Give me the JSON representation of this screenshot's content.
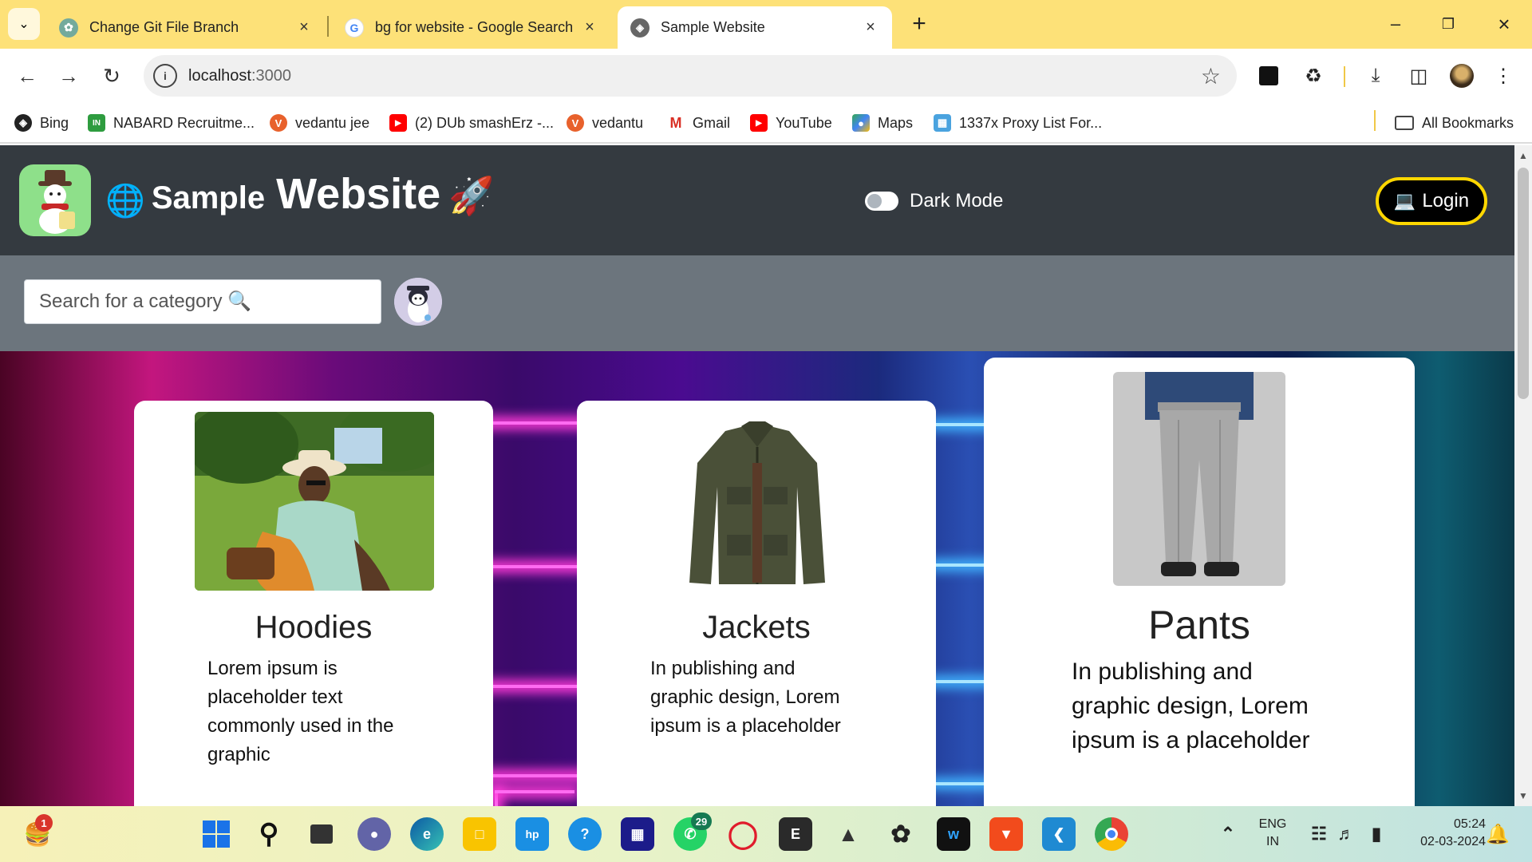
{
  "browser": {
    "tabs": [
      {
        "title": "Change Git File Branch"
      },
      {
        "title": "bg for website - Google Search"
      },
      {
        "title": "Sample Website"
      }
    ],
    "address": {
      "host": "localhost",
      "port": ":3000"
    },
    "bookmarks": [
      {
        "label": "Bing"
      },
      {
        "label": "NABARD Recruitme..."
      },
      {
        "label": "vedantu jee"
      },
      {
        "label": "(2) DUb smashErz -..."
      },
      {
        "label": "vedantu"
      },
      {
        "label": "Gmail"
      },
      {
        "label": "YouTube"
      },
      {
        "label": "Maps"
      },
      {
        "label": "1337x Proxy List For..."
      }
    ],
    "all_bookmarks_label": "All Bookmarks"
  },
  "site": {
    "brand_small": "Sample",
    "brand_large": "Website",
    "dark_mode_label": "Dark Mode",
    "login_label": "Login",
    "search_placeholder": "Search for a category 🔍"
  },
  "cards": [
    {
      "title": "Hoodies",
      "text": "Lorem ipsum is placeholder text commonly used in the graphic"
    },
    {
      "title": "Jackets",
      "text": "In publishing and graphic design, Lorem ipsum is a placeholder"
    },
    {
      "title": "Pants",
      "text": "In publishing and graphic design, Lorem ipsum is a placeholder"
    }
  ],
  "taskbar": {
    "notification_count": "1",
    "whatsapp_count": "29",
    "lang_top": "ENG",
    "lang_bottom": "IN",
    "time": "05:24",
    "date": "02-03-2024",
    "epic_label": "E"
  },
  "colors": {
    "tabstrip": "#fde178",
    "site_header": "#343a40",
    "search_bar": "#6c757d",
    "login_border": "#ffd700"
  }
}
